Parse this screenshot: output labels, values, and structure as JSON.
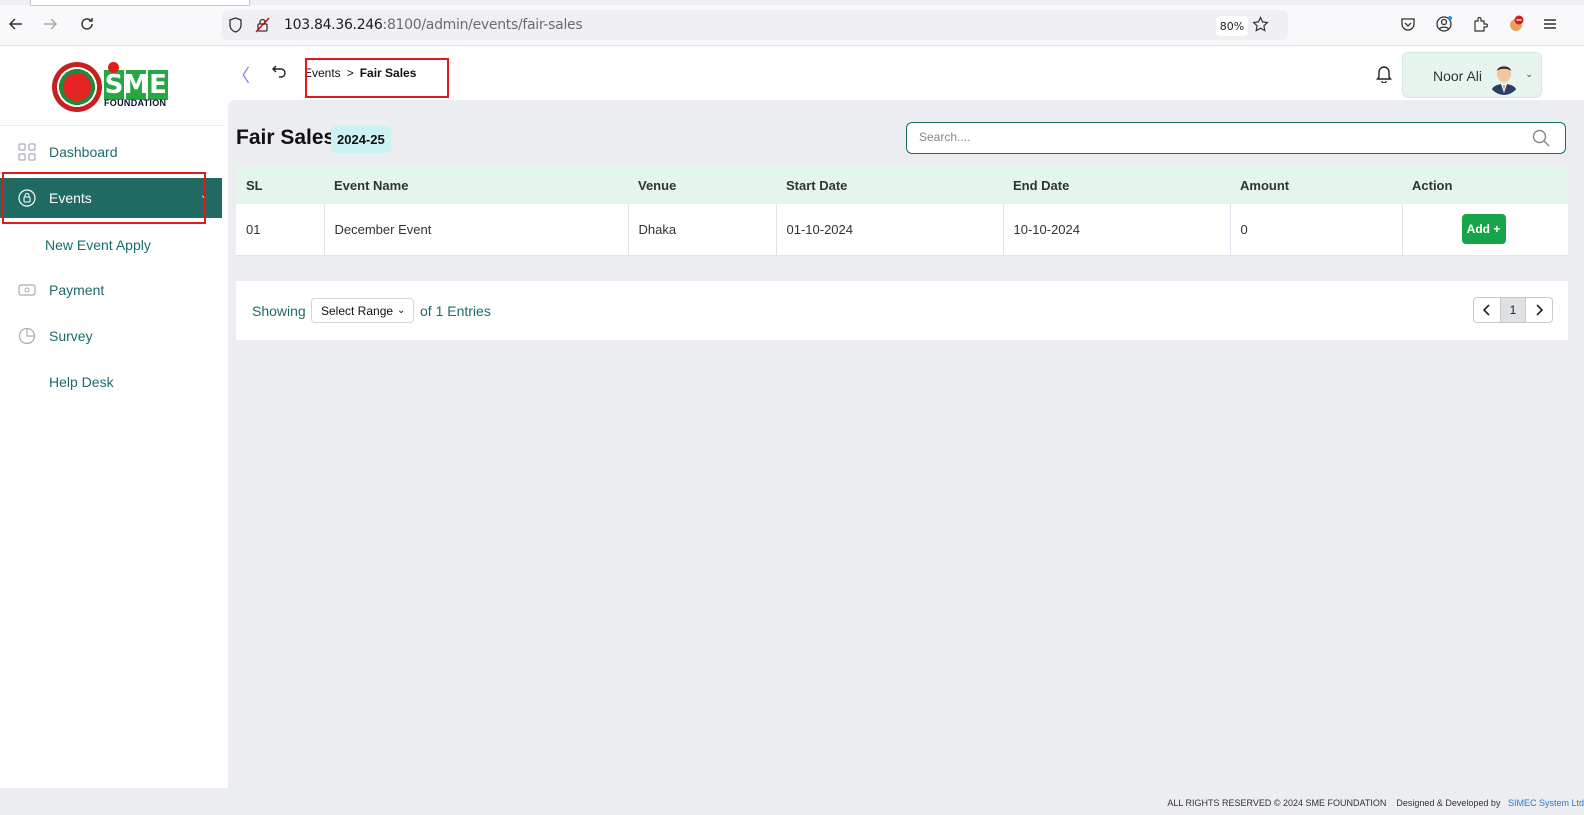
{
  "browser": {
    "url_host": "103.84.36.246",
    "url_rest": ":8100/admin/events/fair-sales",
    "zoom": "80%"
  },
  "logo": {
    "brand": "SME",
    "foundation": "FOUNDATION"
  },
  "sidebar": {
    "items": [
      {
        "label": "Dashboard",
        "icon": "grid-icon"
      },
      {
        "label": "Events",
        "icon": "lock-icon",
        "active": true
      },
      {
        "label": "New Event Apply"
      },
      {
        "label": "Payment",
        "icon": "card-icon"
      },
      {
        "label": "Survey",
        "icon": "pie-icon"
      },
      {
        "label": "Help Desk"
      }
    ]
  },
  "header": {
    "breadcrumb_parent": "Events",
    "breadcrumb_separator": ">",
    "breadcrumb_current": "Fair Sales",
    "user_name": "Noor Ali"
  },
  "page": {
    "title": "Fair Sales",
    "year_badge": "2024-25",
    "search_placeholder": "Search...."
  },
  "table": {
    "columns": [
      "SL",
      "Event Name",
      "Venue",
      "Start Date",
      "End Date",
      "Amount",
      "Action"
    ],
    "rows": [
      {
        "sl": "01",
        "event_name": "December Event",
        "venue": "Dhaka",
        "start_date": "01-10-2024",
        "end_date": "10-10-2024",
        "amount": "0",
        "action_label": "Add +"
      }
    ]
  },
  "pagination": {
    "showing_label": "Showing",
    "range_select": "Select Range",
    "entries_label": "of 1 Entries",
    "current_page": "1"
  },
  "footer": {
    "rights": "ALL RIGHTS RESERVED © 2024 SME FOUNDATION",
    "designed_by": "Designed & Developed by",
    "developer": "SIMEC System Ltd"
  },
  "colors": {
    "primary": "#1f6b63",
    "accent_green": "#16a34a",
    "table_header": "#e4f6ec",
    "highlight_red": "#e21a1a"
  }
}
